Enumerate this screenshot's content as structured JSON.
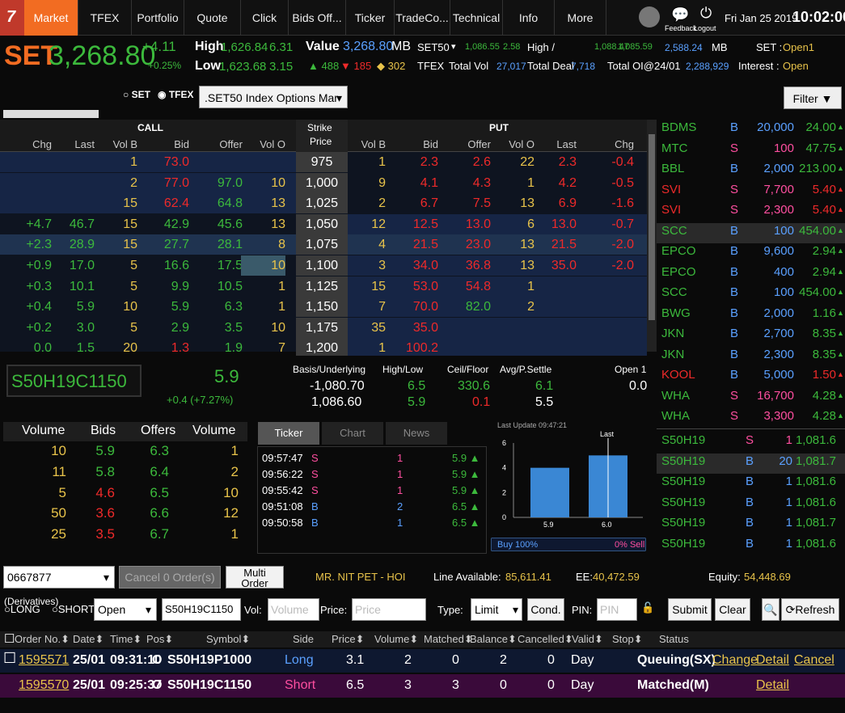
{
  "nav": {
    "items": [
      "Market",
      "TFEX",
      "Portfolio",
      "Quote",
      "Click",
      "Bids Off...",
      "Ticker",
      "TradeCo...",
      "Technical",
      "Info",
      "More"
    ],
    "feedback": "Feedback",
    "logout": "Logout",
    "date": "Fri Jan 25 2019",
    "time": "10:02:00"
  },
  "index": {
    "name": "SET",
    "value": "3,268.80",
    "chg": "+4.11",
    "pct": "+0.25%",
    "high_l": "High",
    "high": "1,626.84",
    "high_chg": "6.31",
    "low_l": "Low",
    "low": "1,623.68",
    "low_chg": "3.15",
    "value_l": "Value",
    "value_u": "MB",
    "up": "488",
    "down": "185",
    "unch": "302",
    "set50_l": "SET50",
    "set50_v": "1,086.55",
    "set50_c": "2.58",
    "hl_l": "High /",
    "hl_h": "1,088.47",
    "hl_l2": "1,085.59",
    "set50_val": "2,588.24",
    "set50_u": "MB",
    "set_st_l": "SET :",
    "set_st": "Open1",
    "tfex_l": "TFEX",
    "tv_l": "Total Vol",
    "tv": "27,017",
    "td_l": "Total Deal",
    "td": "7,718",
    "toi_l": "Total OI@24/01",
    "toi": "2,288,929",
    "int_l": "Interest :",
    "int": "Open"
  },
  "filter": {
    "set": "SET",
    "tfex": "TFEX",
    "select": ".SET50 Index Options Mar",
    "btn": "Filter"
  },
  "opt_hdr": {
    "call": "CALL",
    "put": "PUT",
    "strike1": "Strike",
    "strike2": "Price",
    "chg": "Chg",
    "last": "Last",
    "volb": "Vol B",
    "bid": "Bid",
    "offer": "Offer",
    "volo": "Vol O"
  },
  "options": [
    [
      "",
      "",
      "1",
      "73.0",
      "",
      "",
      "975",
      "1",
      "2.3",
      "2.6",
      "22",
      "2.3",
      "-0.4"
    ],
    [
      "",
      "",
      "2",
      "77.0",
      "97.0",
      "10",
      "1,000",
      "9",
      "4.1",
      "4.3",
      "1",
      "4.2",
      "-0.5"
    ],
    [
      "",
      "",
      "15",
      "62.4",
      "64.8",
      "13",
      "1,025",
      "2",
      "6.7",
      "7.5",
      "13",
      "6.9",
      "-1.6"
    ],
    [
      "+4.7",
      "46.7",
      "15",
      "42.9",
      "45.6",
      "13",
      "1,050",
      "12",
      "12.5",
      "13.0",
      "6",
      "13.0",
      "-0.7"
    ],
    [
      "+2.3",
      "28.9",
      "15",
      "27.7",
      "28.1",
      "8",
      "1,075",
      "4",
      "21.5",
      "23.0",
      "13",
      "21.5",
      "-2.0"
    ],
    [
      "+0.9",
      "17.0",
      "5",
      "16.6",
      "17.5",
      "10",
      "1,100",
      "3",
      "34.0",
      "36.8",
      "13",
      "35.0",
      "-2.0"
    ],
    [
      "+0.3",
      "10.1",
      "5",
      "9.9",
      "10.5",
      "1",
      "1,125",
      "15",
      "53.0",
      "54.8",
      "1",
      "",
      ""
    ],
    [
      "+0.4",
      "5.9",
      "10",
      "5.9",
      "6.3",
      "1",
      "1,150",
      "7",
      "70.0",
      "82.0",
      "2",
      "",
      ""
    ],
    [
      "+0.2",
      "3.0",
      "5",
      "2.9",
      "3.5",
      "10",
      "1,175",
      "35",
      "35.0",
      "",
      "",
      "",
      ""
    ],
    [
      "0.0",
      "1.5",
      "20",
      "1.3",
      "1.9",
      "7",
      "1,200",
      "1",
      "100.2",
      "",
      "",
      "",
      ""
    ]
  ],
  "ticker_right": [
    [
      "BDMS",
      "B",
      "20,000",
      "24.00"
    ],
    [
      "MTC",
      "S",
      "100",
      "47.75"
    ],
    [
      "BBL",
      "B",
      "2,000",
      "213.00"
    ],
    [
      "SVI",
      "S",
      "7,700",
      "5.40"
    ],
    [
      "SVI",
      "S",
      "2,300",
      "5.40"
    ],
    [
      "SCC",
      "B",
      "100",
      "454.00"
    ],
    [
      "EPCO",
      "B",
      "9,600",
      "2.94"
    ],
    [
      "EPCO",
      "B",
      "400",
      "2.94"
    ],
    [
      "SCC",
      "B",
      "100",
      "454.00"
    ],
    [
      "BWG",
      "B",
      "2,000",
      "1.16"
    ],
    [
      "JKN",
      "B",
      "2,700",
      "8.35"
    ],
    [
      "JKN",
      "B",
      "2,300",
      "8.35"
    ],
    [
      "KOOL",
      "B",
      "5,000",
      "1.50"
    ],
    [
      "WHA",
      "S",
      "16,700",
      "4.28"
    ],
    [
      "WHA",
      "S",
      "3,300",
      "4.28"
    ]
  ],
  "ticker_right2": [
    [
      "S50H19",
      "S",
      "1",
      "1,081.6"
    ],
    [
      "S50H19",
      "B",
      "20",
      "1,081.7"
    ],
    [
      "S50H19",
      "B",
      "1",
      "1,081.6"
    ],
    [
      "S50H19",
      "B",
      "1",
      "1,081.6"
    ],
    [
      "S50H19",
      "B",
      "1",
      "1,081.7"
    ],
    [
      "S50H19",
      "B",
      "1",
      "1,081.6"
    ]
  ],
  "quote": {
    "symbol": "S50H19C1150",
    "last": "5.9",
    "chg": "+0.4 (+7.27%)",
    "basis_l": "Basis/Underlying",
    "basis": "-1,080.70",
    "under": "1,086.60",
    "hl_l": "High/Low",
    "high": "6.5",
    "low": "5.9",
    "cf_l": "Ceil/Floor",
    "ceil": "330.6",
    "floor": "0.1",
    "avg_l": "Avg/P.Settle",
    "avg": "6.1",
    "settle": "5.5",
    "open_l": "Open 1",
    "open": "0.0"
  },
  "depth": {
    "h": [
      "Volume",
      "Bids",
      "Offers",
      "Volume"
    ],
    "rows": [
      [
        "10",
        "5.9",
        "6.3",
        "1"
      ],
      [
        "11",
        "5.8",
        "6.4",
        "2"
      ],
      [
        "5",
        "4.6",
        "6.5",
        "10"
      ],
      [
        "50",
        "3.6",
        "6.6",
        "12"
      ],
      [
        "25",
        "3.5",
        "6.7",
        "1"
      ]
    ]
  },
  "tabs": [
    "Ticker",
    "Chart",
    "News"
  ],
  "ticks": [
    [
      "09:57:47",
      "S",
      "1",
      "5.9"
    ],
    [
      "09:56:22",
      "S",
      "1",
      "5.9"
    ],
    [
      "09:55:42",
      "S",
      "1",
      "5.9"
    ],
    [
      "09:51:08",
      "B",
      "2",
      "6.5"
    ],
    [
      "09:50:58",
      "B",
      "1",
      "6.5"
    ]
  ],
  "chart_data": {
    "type": "bar",
    "title": "Last Update 09:47:21",
    "categories": [
      "5.9",
      "6.0"
    ],
    "values": [
      4,
      5
    ],
    "ylim": [
      0,
      6
    ],
    "yticks": [
      "0",
      "2",
      "4",
      "6"
    ],
    "annotation": "Last",
    "buy": "Buy 100%",
    "sell": "0% Sell"
  },
  "order": {
    "acct": "0667877",
    "cancel": "Cancel 0 Order(s)",
    "multi1": "Multi",
    "multi2": "Order",
    "name": "MR. NIT PET - HOI",
    "line_l": "Line Available:",
    "line": "85,611.41",
    "ee_l": "EE:",
    "ee": "40,472.59",
    "eq_l": "Equity:",
    "eq": "54,448.69",
    "deriv": "(Derivatives)",
    "long": "LONG",
    "short": "SHORT",
    "pos": "Open",
    "sym": "S50H19C1150",
    "vol_l": "Vol:",
    "vol_ph": "Volume",
    "price_l": "Price:",
    "price_ph": "Price",
    "type_l": "Type:",
    "type": "Limit",
    "cond": "Cond.",
    "pin_l": "PIN:",
    "pin_ph": "PIN",
    "submit": "Submit",
    "clear": "Clear",
    "refresh": "Refresh"
  },
  "orders_hdr": [
    "Order No.",
    "Date",
    "Time",
    "Pos",
    "Symbol",
    "Side",
    "Price",
    "Volume",
    "Matched",
    "Balance",
    "Cancelled",
    "Valid",
    "Stop",
    "Status"
  ],
  "orders": [
    [
      "1595571",
      "25/01",
      "09:31:10",
      "O",
      "S50H19P1000",
      "Long",
      "3.1",
      "2",
      "0",
      "2",
      "0",
      "Day",
      "Queuing(SX)",
      "Change",
      "Detail",
      "Cancel"
    ],
    [
      "1595570",
      "25/01",
      "09:25:37",
      "O",
      "S50H19C1150",
      "Short",
      "6.5",
      "3",
      "3",
      "0",
      "0",
      "Day",
      "Matched(M)",
      "",
      "Detail",
      ""
    ]
  ]
}
